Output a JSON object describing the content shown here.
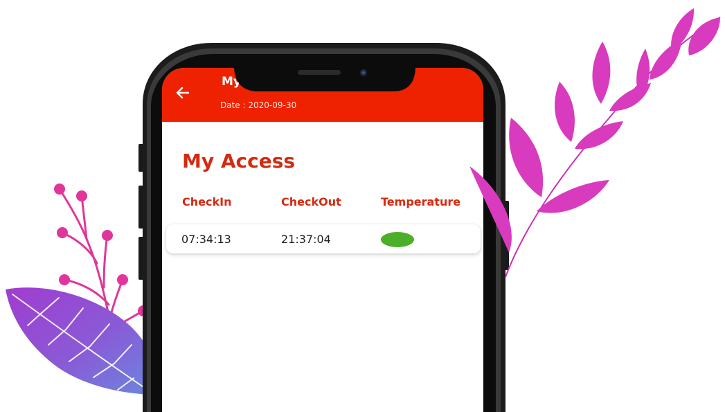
{
  "app_bar": {
    "title": "My",
    "date": "Date : 2020-09-30",
    "color": "#ee2200"
  },
  "page": {
    "heading": "My Access",
    "heading_color": "#d42a10"
  },
  "table": {
    "columns": [
      "CheckIn",
      "CheckOut",
      "Temperature"
    ],
    "rows": [
      {
        "checkin": "07:34:13",
        "checkout": "21:37:04",
        "temperature_status_color": "#4caf2a"
      }
    ]
  },
  "icons": {
    "back": "arrow-left-icon"
  }
}
